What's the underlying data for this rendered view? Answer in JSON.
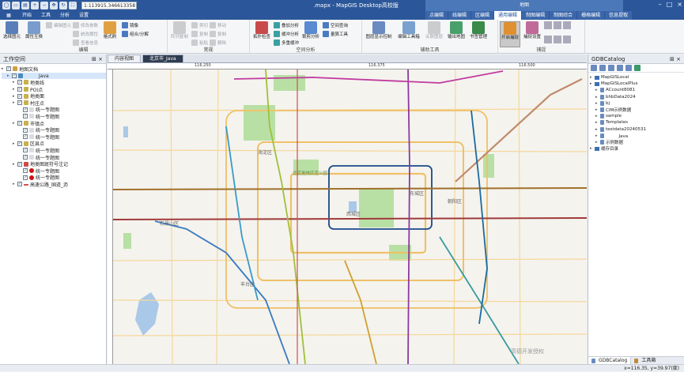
{
  "titlebar": {
    "scale": "1:113915.346613358",
    "title": "　　　　　.mapx - MapGIS Desktop高校版",
    "ctx_group_title": "地图"
  },
  "menu": {
    "file_tab": "▦",
    "tabs": [
      "开始",
      "工具",
      "分析",
      "设置"
    ],
    "context_tabs": [
      "点编辑",
      "线编辑",
      "区编辑",
      "通用编辑",
      "制图编辑",
      "制图综合",
      "栅格编辑",
      "信息提取"
    ],
    "active_context_tab": "通用编辑"
  },
  "ribbon": {
    "groups": {
      "edit": "编辑",
      "normal": "常规",
      "spatial": "空间分析",
      "aux": "辅助工具",
      "snap": "捕捉"
    },
    "buttons": {
      "select": "选择图元",
      "reverse": "属性互换",
      "edit_elem": "编辑图元",
      "edit_param": "修改参数",
      "unify_attr": "统改属性",
      "edit_info": "查看信息",
      "tpl_brush": "格式刷",
      "mirror": "镜像",
      "combine_split": "组合/分解",
      "layer_copy": "阵列复制",
      "cut": "剪切",
      "copy": "复制",
      "paste": "粘贴",
      "move": "移动",
      "dup": "复制",
      "delete": "删除",
      "topo_check": "拓扑检查",
      "overlay": "叠加分析",
      "buffer": "缓冲分析",
      "multi_overlay": "多重缓冲",
      "clip": "裁剪分析",
      "spatial_query": "空间查询",
      "measure": "量算工具",
      "layer_display": "图层显示控制",
      "edit_toolbox": "编辑工具箱",
      "related": "关联图层",
      "export_map": "输出地图",
      "bookmark": "书签管理",
      "start_snap": "开启捕捉",
      "snap_settings": "捕捉设置"
    }
  },
  "workspace": {
    "title": "工作空间",
    "tree": [
      {
        "level": 0,
        "label": "地图文档",
        "type": "root"
      },
      {
        "level": 1,
        "label": "　　　Java",
        "type": "map"
      },
      {
        "level": 2,
        "label": "地类线",
        "type": "layer",
        "color": "#c8b04a"
      },
      {
        "level": 2,
        "label": "POI点",
        "type": "layer",
        "color": "#c8b04a"
      },
      {
        "level": 2,
        "label": "地类面",
        "type": "layer",
        "color": "#c8b04a"
      },
      {
        "level": 2,
        "label": "村庄点",
        "type": "layer",
        "color": "#c8b04a"
      },
      {
        "level": 3,
        "label": "统一专题图",
        "type": "sub"
      },
      {
        "level": 3,
        "label": "统一专题图",
        "type": "sub"
      },
      {
        "level": 2,
        "label": "市镇点",
        "type": "layer",
        "color": "#c8b04a"
      },
      {
        "level": 3,
        "label": "统一专题图",
        "type": "sub"
      },
      {
        "level": 3,
        "label": "统一专题图",
        "type": "sub"
      },
      {
        "level": 2,
        "label": "区县点",
        "type": "layer",
        "color": "#c8b04a"
      },
      {
        "level": 3,
        "label": "统一专题图",
        "type": "sub"
      },
      {
        "level": 3,
        "label": "统一专题图",
        "type": "sub"
      },
      {
        "level": 2,
        "label": "地类图斑符号注记",
        "type": "layer",
        "color": "#d04a4a"
      },
      {
        "level": 3,
        "label": "统一专题图",
        "type": "dot",
        "color": "#d01010"
      },
      {
        "level": 3,
        "label": "统一专题图",
        "type": "dot",
        "color": "#d01010"
      },
      {
        "level": 2,
        "label": "高速公路_国道_沥",
        "type": "line",
        "color": "#d05050"
      }
    ]
  },
  "doc_tabs": [
    {
      "label": "内容视图",
      "active": false
    },
    {
      "label": "北京市_Java",
      "active": true
    }
  ],
  "map": {
    "ruler_labels": [
      "116.250",
      "116.375",
      "116.500"
    ],
    "place_labels": [
      "海淀区",
      "东城区",
      "西城区",
      "石景山区",
      "丰台区",
      "朝阳区",
      "北京奥林匹克公园"
    ],
    "watermark": "高德开发授权"
  },
  "catalog": {
    "title": "GDBCatalog",
    "tree": [
      {
        "level": 0,
        "label": "MapGISLocal",
        "kind": "folder"
      },
      {
        "level": 0,
        "label": "MapGISLocalPlus",
        "kind": "folder"
      },
      {
        "level": 1,
        "label": "ACcount8081",
        "kind": "db"
      },
      {
        "level": 1,
        "label": "bhbData2024",
        "kind": "db"
      },
      {
        "level": 1,
        "label": "bj",
        "kind": "db"
      },
      {
        "level": 1,
        "label": "CIM示例数据",
        "kind": "db"
      },
      {
        "level": 1,
        "label": "sample",
        "kind": "db"
      },
      {
        "level": 1,
        "label": "Templates",
        "kind": "db"
      },
      {
        "level": 1,
        "label": "testdata20240531",
        "kind": "db"
      },
      {
        "level": 1,
        "label": "　　　Java",
        "kind": "db"
      },
      {
        "level": 1,
        "label": "示例数据",
        "kind": "db"
      },
      {
        "level": 0,
        "label": "缓存目录",
        "kind": "folder"
      }
    ],
    "bottom_tabs": [
      "GDBCatalog",
      "工具箱"
    ]
  },
  "status": {
    "coords": "x=116.35, y=39.97(度)"
  },
  "colors": {
    "ribbon_blue": "#2b579a",
    "map_bg": "#f4f3ee"
  }
}
